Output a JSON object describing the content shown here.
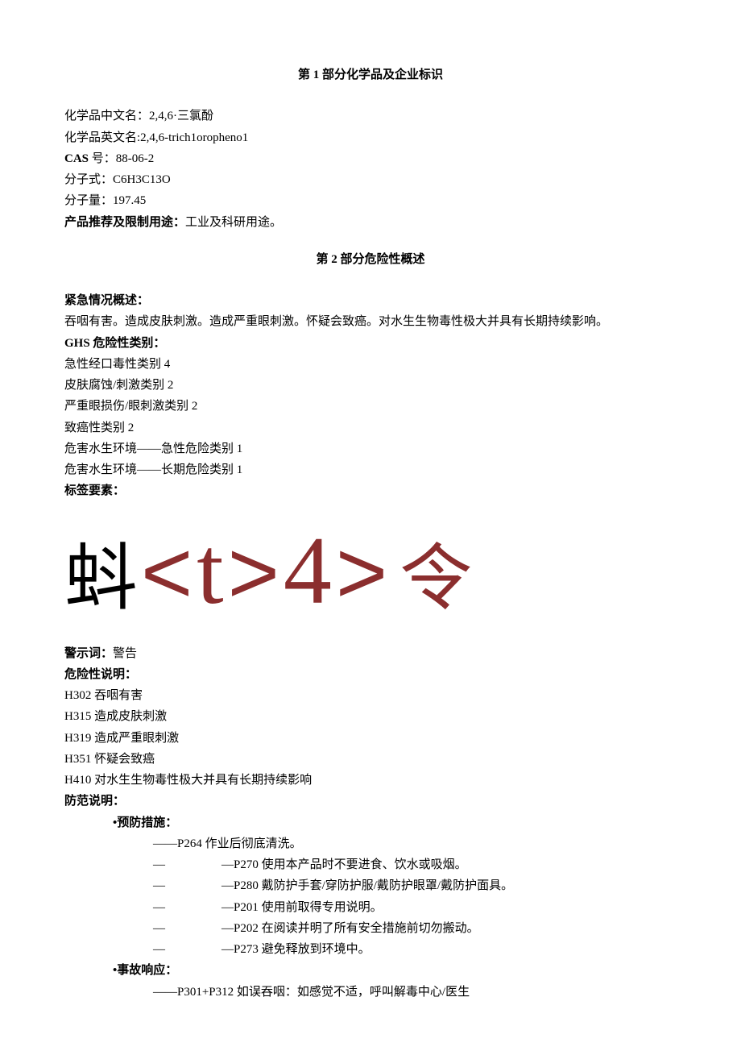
{
  "section1": {
    "title": "第 1 部分化学品及企业标识",
    "chineseNameLabel": "化学品中文名：",
    "chineseName": "2,4,6·三氯酚",
    "englishNameLabel": "化学品英文名:",
    "englishName": "2,4,6-trich1oropheno1",
    "casLabel": "CAS",
    "casSuffix": " 号：",
    "casNumber": "88-06-2",
    "formulaLabel": "分子式：",
    "formula": "C6H3C13O",
    "weightLabel": "分子量：",
    "weight": "197.45",
    "useLabel": "产品推荐及限制用途：",
    "use": "工业及科研用途。"
  },
  "section2": {
    "title": "第 2 部分危险性概述",
    "emergencyLabel": "紧急情况概述：",
    "emergencyText": "吞咽有害。造成皮肤刺激。造成严重眼刺激。怀疑会致癌。对水生生物毒性极大并具有长期持续影响。",
    "ghsLabel": "GHS 危险性类别：",
    "ghs": [
      "急性经口毒性类别 4",
      "皮肤腐蚀/刺激类别 2",
      "严重眼损伤/眼刺激类别 2",
      "致癌性类别 2",
      "危害水生环境——急性危险类别 1",
      "危害水生环境——长期危险类别 1"
    ],
    "labelElementsLabel": "标签要素：",
    "pictograms": {
      "p1": "蚪",
      "b1": "<",
      "t": "t",
      "b2": ">",
      "four": "4",
      "b3": ">",
      "p2": "令"
    },
    "signalLabel": "警示词：",
    "signalWord": "警告",
    "hazardLabel": "危险性说明：",
    "hazards": [
      "H302 吞咽有害",
      "H315 造成皮肤刺激",
      "H319 造成严重眼刺激",
      "H351 怀疑会致癌",
      "H410 对水生生物毒性极大并具有长期持续影响"
    ],
    "precautionLabel": "防范说明：",
    "preventionLabel": "•预防措施：",
    "prevention": {
      "p264": "——P264 作业后彻底清洗。",
      "p270": "—P270 使用本产品时不要进食、饮水或吸烟。",
      "p280": "—P280 戴防护手套/穿防护服/戴防护眼罩/戴防护面具。",
      "p201": "—P201 使用前取得专用说明。",
      "p202": "—P202 在阅读并明了所有安全措施前切勿搬动。",
      "p273": "—P273 避免释放到环境中。"
    },
    "responseLabel": "•事故响应：",
    "response": {
      "p301": "——P301+P312 如误吞咽：如感觉不适，呼叫解毒中心/医生"
    },
    "dashShort": "—",
    "dashSpace": " "
  }
}
